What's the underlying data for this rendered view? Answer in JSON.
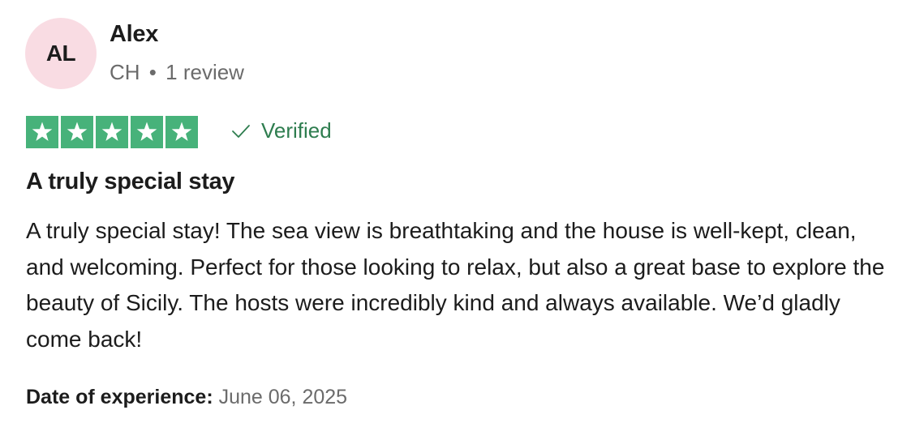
{
  "reviewer": {
    "initials": "AL",
    "name": "Alex",
    "country": "CH",
    "separator": "•",
    "review_count": "1 review",
    "avatar_bg": "#f9dce3"
  },
  "rating": {
    "stars": 5,
    "max": 5,
    "star_color": "#47b27a",
    "star_icon": "star-icon"
  },
  "verified": {
    "label": "Verified",
    "icon": "check-icon",
    "color": "#2e7d4f"
  },
  "review": {
    "title": "A truly special stay",
    "body": "A truly special stay! The sea view is breathtaking and the house is well-kept, clean, and welcoming. Perfect for those looking to relax, but also a great base to explore the beauty of Sicily. The hosts were incredibly kind and always available. We’d gladly come back!"
  },
  "experience": {
    "label": "Date of experience:",
    "date": "June 06, 2025"
  }
}
